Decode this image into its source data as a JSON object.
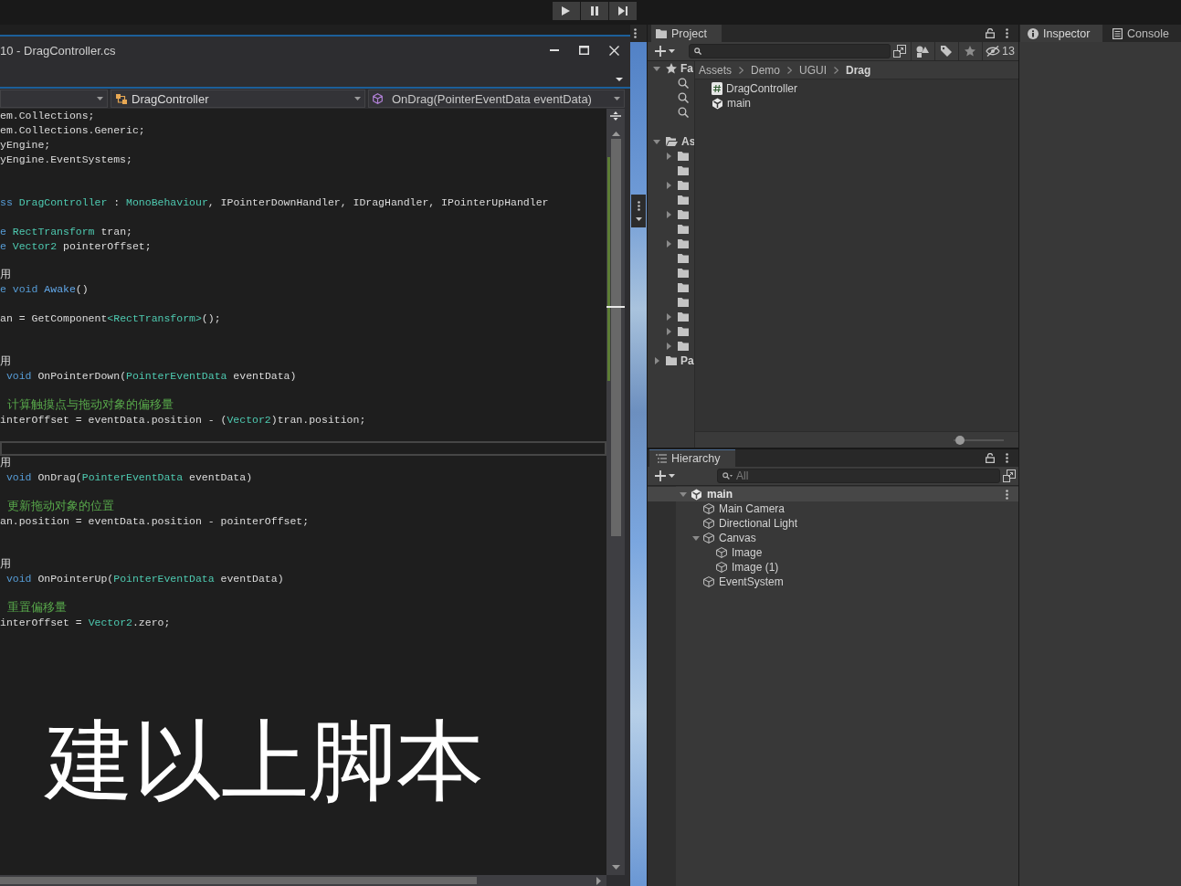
{
  "editor": {
    "title": "10 - DragController.cs",
    "nav": [
      {
        "kind": "project"
      },
      {
        "kind": "class",
        "label": "DragController"
      },
      {
        "kind": "member",
        "label": "OnDrag(PointerEventData eventData)"
      }
    ],
    "lines": [
      {
        "kind": "code",
        "current": false,
        "segments": [
          {
            "kind": "plain",
            "text": "em.Collections;"
          }
        ]
      },
      {
        "kind": "code",
        "current": false,
        "segments": [
          {
            "kind": "plain",
            "text": "em.Collections.Generic;"
          }
        ]
      },
      {
        "kind": "code",
        "current": false,
        "segments": [
          {
            "kind": "plain",
            "text": "yEngine;"
          }
        ]
      },
      {
        "kind": "code",
        "current": false,
        "segments": [
          {
            "kind": "plain",
            "text": "yEngine.EventSystems;"
          }
        ]
      },
      {
        "kind": "blank",
        "current": false
      },
      {
        "kind": "blank",
        "current": false
      },
      {
        "kind": "code",
        "current": false,
        "segments": [
          {
            "kind": "keyword",
            "text": "ss"
          },
          {
            "kind": "type",
            "text": " DragController"
          },
          {
            "kind": "plain",
            "text": " : "
          },
          {
            "kind": "type",
            "text": "MonoBehaviour"
          },
          {
            "kind": "plain",
            "text": ", IPointerDownHandler, IDragHandler, IPointerUpHandler"
          }
        ]
      },
      {
        "kind": "blank",
        "current": false
      },
      {
        "kind": "code",
        "current": false,
        "segments": [
          {
            "kind": "keyword",
            "text": "e"
          },
          {
            "kind": "type",
            "text": " RectTransform"
          },
          {
            "kind": "plain",
            "text": " tran;"
          }
        ]
      },
      {
        "kind": "code",
        "current": false,
        "segments": [
          {
            "kind": "keyword",
            "text": "e"
          },
          {
            "kind": "type",
            "text": " Vector2"
          },
          {
            "kind": "plain",
            "text": " pointerOffset;"
          }
        ]
      },
      {
        "kind": "blank",
        "current": false
      },
      {
        "kind": "code",
        "current": false,
        "segments": [
          {
            "kind": "plain",
            "text": "用"
          }
        ]
      },
      {
        "kind": "code",
        "current": false,
        "segments": [
          {
            "kind": "keyword",
            "text": "e void"
          },
          {
            "kind": "message",
            "text": " Awake"
          },
          {
            "kind": "plain",
            "text": "()"
          }
        ]
      },
      {
        "kind": "blank",
        "current": false
      },
      {
        "kind": "code",
        "current": false,
        "segments": [
          {
            "kind": "plain",
            "text": "an = GetComponent"
          },
          {
            "kind": "type",
            "text": "<RectTransform>"
          },
          {
            "kind": "plain",
            "text": "();"
          }
        ]
      },
      {
        "kind": "blank",
        "current": false
      },
      {
        "kind": "blank",
        "current": false
      },
      {
        "kind": "code",
        "current": false,
        "segments": [
          {
            "kind": "plain",
            "text": "用"
          }
        ]
      },
      {
        "kind": "code",
        "current": false,
        "segments": [
          {
            "kind": "keyword",
            "text": " void"
          },
          {
            "kind": "plain",
            "text": " OnPointerDown("
          },
          {
            "kind": "type",
            "text": "PointerEventData"
          },
          {
            "kind": "plain",
            "text": " eventData)"
          }
        ]
      },
      {
        "kind": "blank",
        "current": false
      },
      {
        "kind": "code",
        "current": false,
        "segments": [
          {
            "kind": "comment",
            "text": " 计算触摸点与拖动对象的偏移量"
          }
        ]
      },
      {
        "kind": "code",
        "current": false,
        "segments": [
          {
            "kind": "plain",
            "text": "interOffset = eventData.position - ("
          },
          {
            "kind": "type",
            "text": "Vector2"
          },
          {
            "kind": "plain",
            "text": ")tran.position;"
          }
        ]
      },
      {
        "kind": "blank",
        "current": false
      },
      {
        "kind": "blank",
        "current": true
      },
      {
        "kind": "code",
        "current": false,
        "segments": [
          {
            "kind": "plain",
            "text": "用"
          }
        ]
      },
      {
        "kind": "code",
        "current": false,
        "segments": [
          {
            "kind": "keyword",
            "text": " void"
          },
          {
            "kind": "plain",
            "text": " OnDrag("
          },
          {
            "kind": "type",
            "text": "PointerEventData"
          },
          {
            "kind": "plain",
            "text": " eventData)"
          }
        ]
      },
      {
        "kind": "blank",
        "current": false
      },
      {
        "kind": "code",
        "current": false,
        "segments": [
          {
            "kind": "comment",
            "text": " 更新拖动对象的位置"
          }
        ]
      },
      {
        "kind": "code",
        "current": false,
        "segments": [
          {
            "kind": "plain",
            "text": "an.position = eventData.position - pointerOffset;"
          }
        ]
      },
      {
        "kind": "blank",
        "current": false
      },
      {
        "kind": "blank",
        "current": false
      },
      {
        "kind": "code",
        "current": false,
        "segments": [
          {
            "kind": "plain",
            "text": "用"
          }
        ]
      },
      {
        "kind": "code",
        "current": false,
        "segments": [
          {
            "kind": "keyword",
            "text": " void"
          },
          {
            "kind": "plain",
            "text": " OnPointerUp("
          },
          {
            "kind": "type",
            "text": "PointerEventData"
          },
          {
            "kind": "plain",
            "text": " eventData)"
          }
        ]
      },
      {
        "kind": "blank",
        "current": false
      },
      {
        "kind": "code",
        "current": false,
        "segments": [
          {
            "kind": "comment",
            "text": " 重置偏移量"
          }
        ]
      },
      {
        "kind": "code",
        "current": false,
        "segments": [
          {
            "kind": "plain",
            "text": "interOffset = "
          },
          {
            "kind": "type",
            "text": "Vector2"
          },
          {
            "kind": "plain",
            "text": ".zero;"
          }
        ]
      }
    ]
  },
  "subtitle": "建以上脚本",
  "project": {
    "tab": "Project",
    "hidden_count": "13",
    "tree": [
      {
        "kind": "favorites",
        "label": "Fa",
        "expanded": true,
        "children": [
          {
            "kind": "search"
          },
          {
            "kind": "search"
          },
          {
            "kind": "search"
          }
        ]
      },
      {
        "kind": "folder",
        "label": "As",
        "expanded": true,
        "children": [
          {
            "kind": "folder",
            "expanded": false
          },
          {
            "kind": "folder"
          },
          {
            "kind": "folder",
            "expanded": false
          },
          {
            "kind": "folder"
          },
          {
            "kind": "folder",
            "expanded": false
          },
          {
            "kind": "folder"
          },
          {
            "kind": "folder",
            "expanded": false
          },
          {
            "kind": "folder"
          },
          {
            "kind": "folder"
          },
          {
            "kind": "folder"
          },
          {
            "kind": "folder"
          },
          {
            "kind": "folder",
            "expanded": false
          },
          {
            "kind": "folder",
            "expanded": false
          },
          {
            "kind": "folder",
            "expanded": false
          }
        ]
      },
      {
        "kind": "folder",
        "label": "Pa",
        "expanded": false
      }
    ],
    "breadcrumb": [
      "Assets",
      "Demo",
      "UGUI",
      "Drag"
    ],
    "items": [
      {
        "kind": "script",
        "label": "DragController"
      },
      {
        "kind": "scene",
        "label": "main"
      }
    ],
    "zoom_slider": {
      "level": 0.05
    }
  },
  "hierarchy": {
    "tab": "Hierarchy",
    "search": {
      "placeholder": "All"
    },
    "tree": [
      {
        "kind": "scene",
        "label": "main",
        "expanded": true,
        "children": [
          {
            "kind": "object",
            "label": "Main Camera"
          },
          {
            "kind": "object",
            "label": "Directional Light"
          },
          {
            "kind": "object",
            "label": "Canvas",
            "expanded": true,
            "children": [
              {
                "kind": "object",
                "label": "Image"
              },
              {
                "kind": "object",
                "label": "Image (1)"
              }
            ]
          },
          {
            "kind": "object",
            "label": "EventSystem"
          }
        ]
      }
    ]
  },
  "side_tabs": [
    {
      "kind": "inspector",
      "label": "Inspector",
      "selected": true
    },
    {
      "kind": "console",
      "label": "Console",
      "selected": false
    }
  ]
}
